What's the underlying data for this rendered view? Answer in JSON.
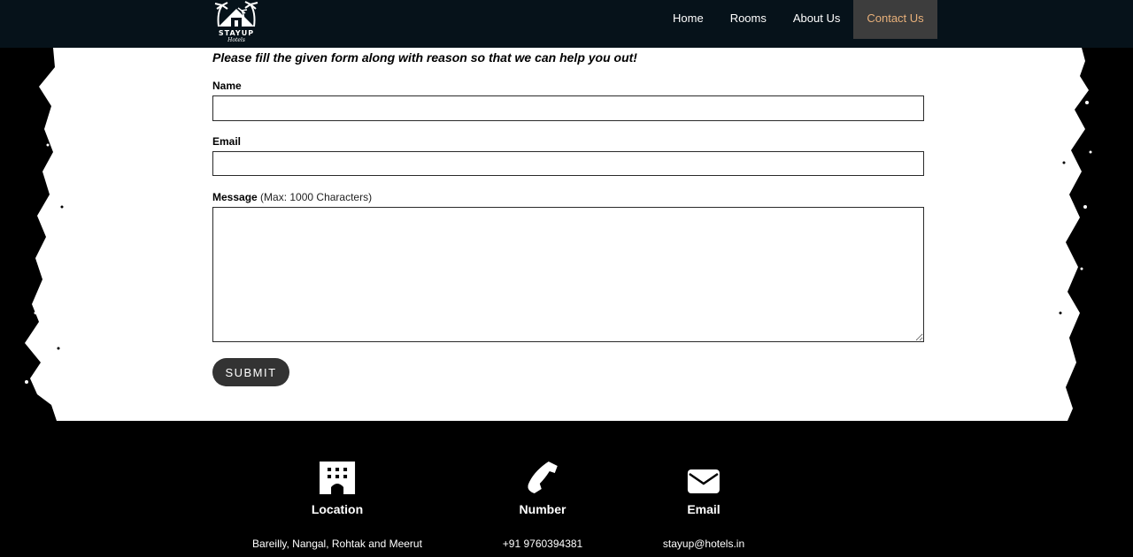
{
  "navbar": {
    "logo": {
      "name": "STAYUP",
      "tagline": "Hotels"
    },
    "links": [
      {
        "label": "Home",
        "active": false
      },
      {
        "label": "Rooms",
        "active": false
      },
      {
        "label": "About Us",
        "active": false
      },
      {
        "label": "Contact Us",
        "active": true
      }
    ]
  },
  "form": {
    "intro": "Please fill the given form along with reason so that we can help you out!",
    "name": {
      "label": "Name",
      "value": ""
    },
    "email": {
      "label": "Email",
      "value": ""
    },
    "message": {
      "label": "Message",
      "hint": "(Max: 1000 Characters)",
      "value": ""
    },
    "submit_label": "SUBMIT"
  },
  "footer": {
    "items": [
      {
        "icon": "building-icon",
        "title": "Location",
        "value": "Bareilly, Nangal, Rohtak and Meerut"
      },
      {
        "icon": "phone-icon",
        "title": "Number",
        "value": "+91 9760394381"
      },
      {
        "icon": "envelope-icon",
        "title": "Email",
        "value": "stayup@hotels.in"
      }
    ]
  },
  "colors": {
    "navbar_bg": "#06121a",
    "active_link_bg": "#3d3d3d",
    "active_link_text": "#e8b07a",
    "submit_bg": "#333333",
    "footer_bg": "#000000"
  }
}
